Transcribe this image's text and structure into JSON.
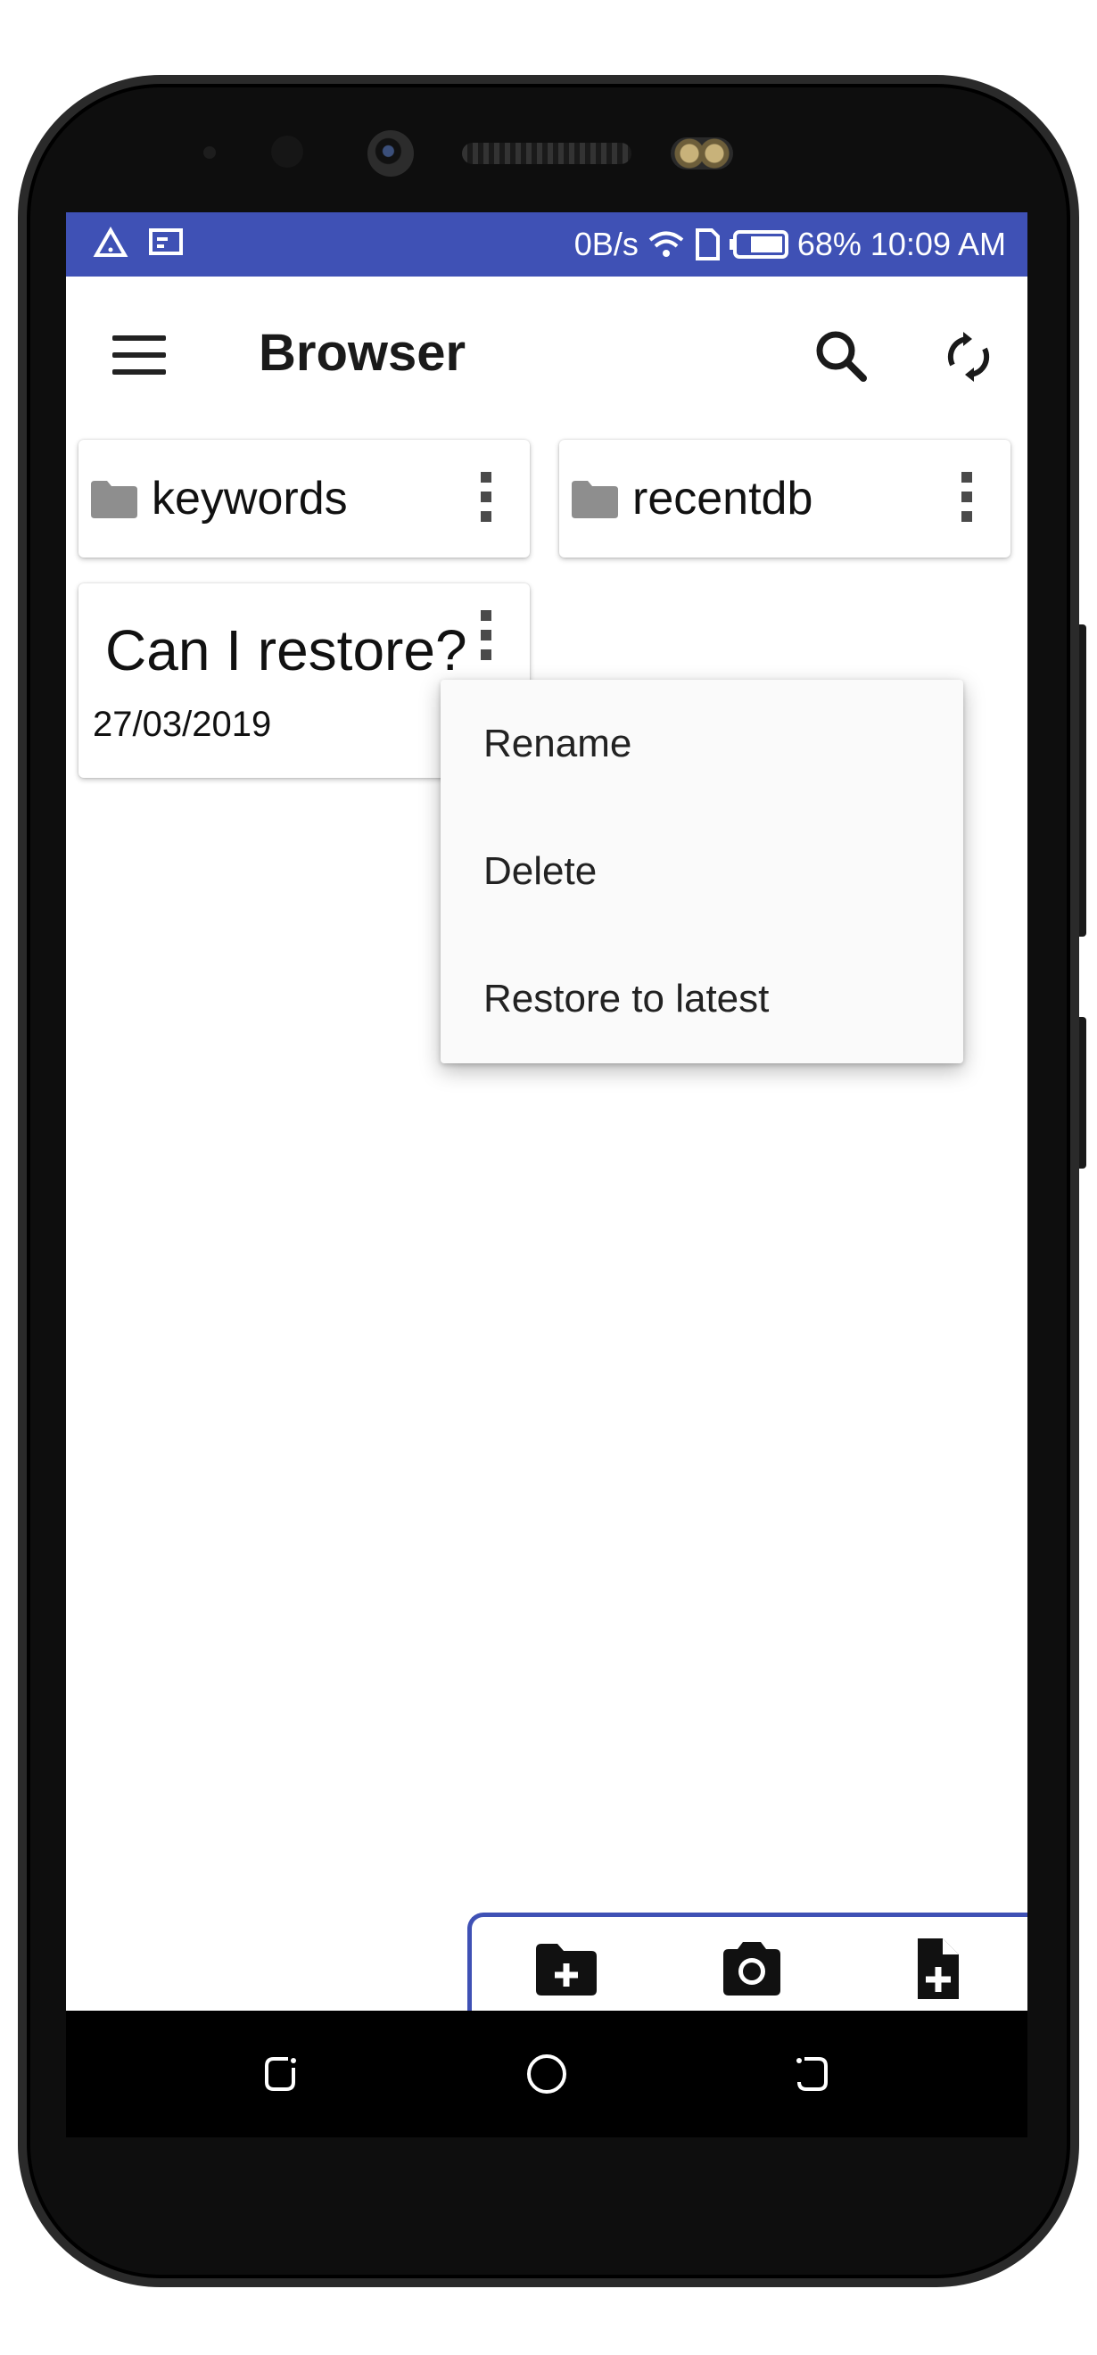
{
  "status_bar": {
    "left_icons": [
      "alert-triangle-icon",
      "cast-icon"
    ],
    "net_speed": "0B/s",
    "battery": "68%",
    "time": "10:09 AM",
    "color": "#3f51b5"
  },
  "app_bar": {
    "title": "Browser",
    "actions": [
      "search-icon",
      "sync-icon"
    ]
  },
  "folders": [
    {
      "name": "keywords"
    },
    {
      "name": "recentdb"
    }
  ],
  "note": {
    "title": "Can I restore?",
    "date": "27/03/2019"
  },
  "context_menu": {
    "items": [
      "Rename",
      "Delete",
      "Restore to latest"
    ]
  },
  "bottom_actions": [
    "add-folder-icon",
    "camera-icon",
    "add-file-icon"
  ],
  "nav_bar": [
    "back-icon",
    "home-icon",
    "recents-icon"
  ]
}
